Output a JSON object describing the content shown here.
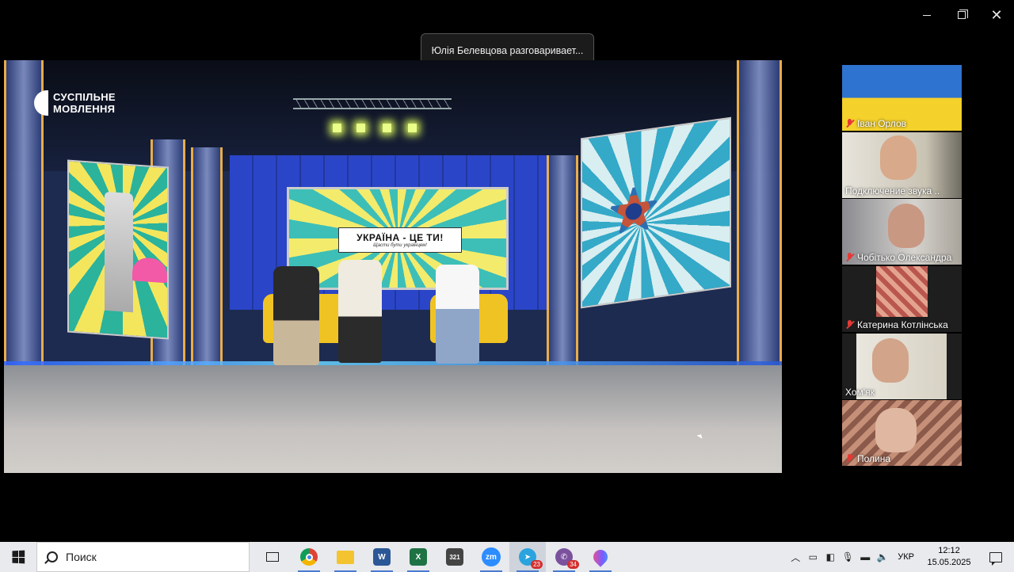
{
  "toast": {
    "text": "Юлія Белевцова разговаривает..."
  },
  "stream": {
    "logo_line1": "СУСПІЛЬНЕ",
    "logo_line2": "МОВЛЕННЯ",
    "set_title": "УКРАЇНА - ЦЕ ТИ!",
    "set_subtitle": "Щасти бути українцем!"
  },
  "participants": [
    {
      "name": "Іван Орлов",
      "muted": true
    },
    {
      "name": "Подключение звука ..",
      "muted": false
    },
    {
      "name": "Чобітько Олександра",
      "muted": true
    },
    {
      "name": "Катерина Котлінська",
      "muted": true
    },
    {
      "name": "Хом'як",
      "muted": false
    },
    {
      "name": "Полина",
      "muted": true
    }
  ],
  "taskbar": {
    "search_placeholder": "Поиск",
    "apps": [
      {
        "name": "task-view",
        "color": "#e8eaed",
        "label": ""
      },
      {
        "name": "chrome",
        "color": "#e8eaed",
        "label": ""
      },
      {
        "name": "file-explorer",
        "color": "#f4c430",
        "label": ""
      },
      {
        "name": "word",
        "color": "#2b5797",
        "label": "W"
      },
      {
        "name": "excel",
        "color": "#1f7244",
        "label": "X"
      },
      {
        "name": "calendar",
        "color": "#444444",
        "label": "321"
      },
      {
        "name": "zoom",
        "color": "#2d8cff",
        "label": "zm"
      },
      {
        "name": "telegram",
        "color": "#2aa3df",
        "label": "",
        "badge": "23"
      },
      {
        "name": "viber",
        "color": "#7b519d",
        "label": "",
        "badge": "34"
      },
      {
        "name": "paint",
        "color": "#e8eaed",
        "label": ""
      }
    ],
    "language": "УКР",
    "time": "12:12",
    "date": "15.05.2025"
  }
}
